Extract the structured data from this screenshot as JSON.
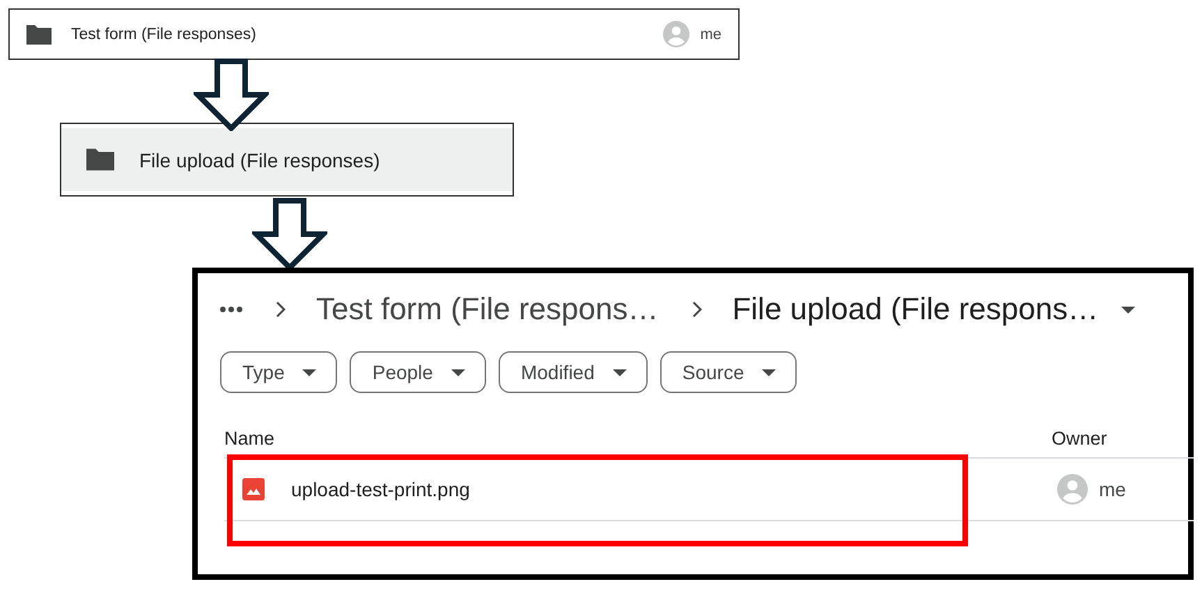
{
  "folder_row": {
    "name": "Test form (File responses)",
    "owner": "me"
  },
  "selected_folder": {
    "name": "File upload (File responses)"
  },
  "drive": {
    "breadcrumb": [
      {
        "label": "Test form (File respons…",
        "current": false
      },
      {
        "label": "File upload (File respons…",
        "current": true
      }
    ],
    "filters": [
      "Type",
      "People",
      "Modified",
      "Source"
    ],
    "columns": [
      "Name",
      "Owner"
    ],
    "files": [
      {
        "name": "upload-test-print.png",
        "owner": "me",
        "highlighted": true
      }
    ]
  }
}
